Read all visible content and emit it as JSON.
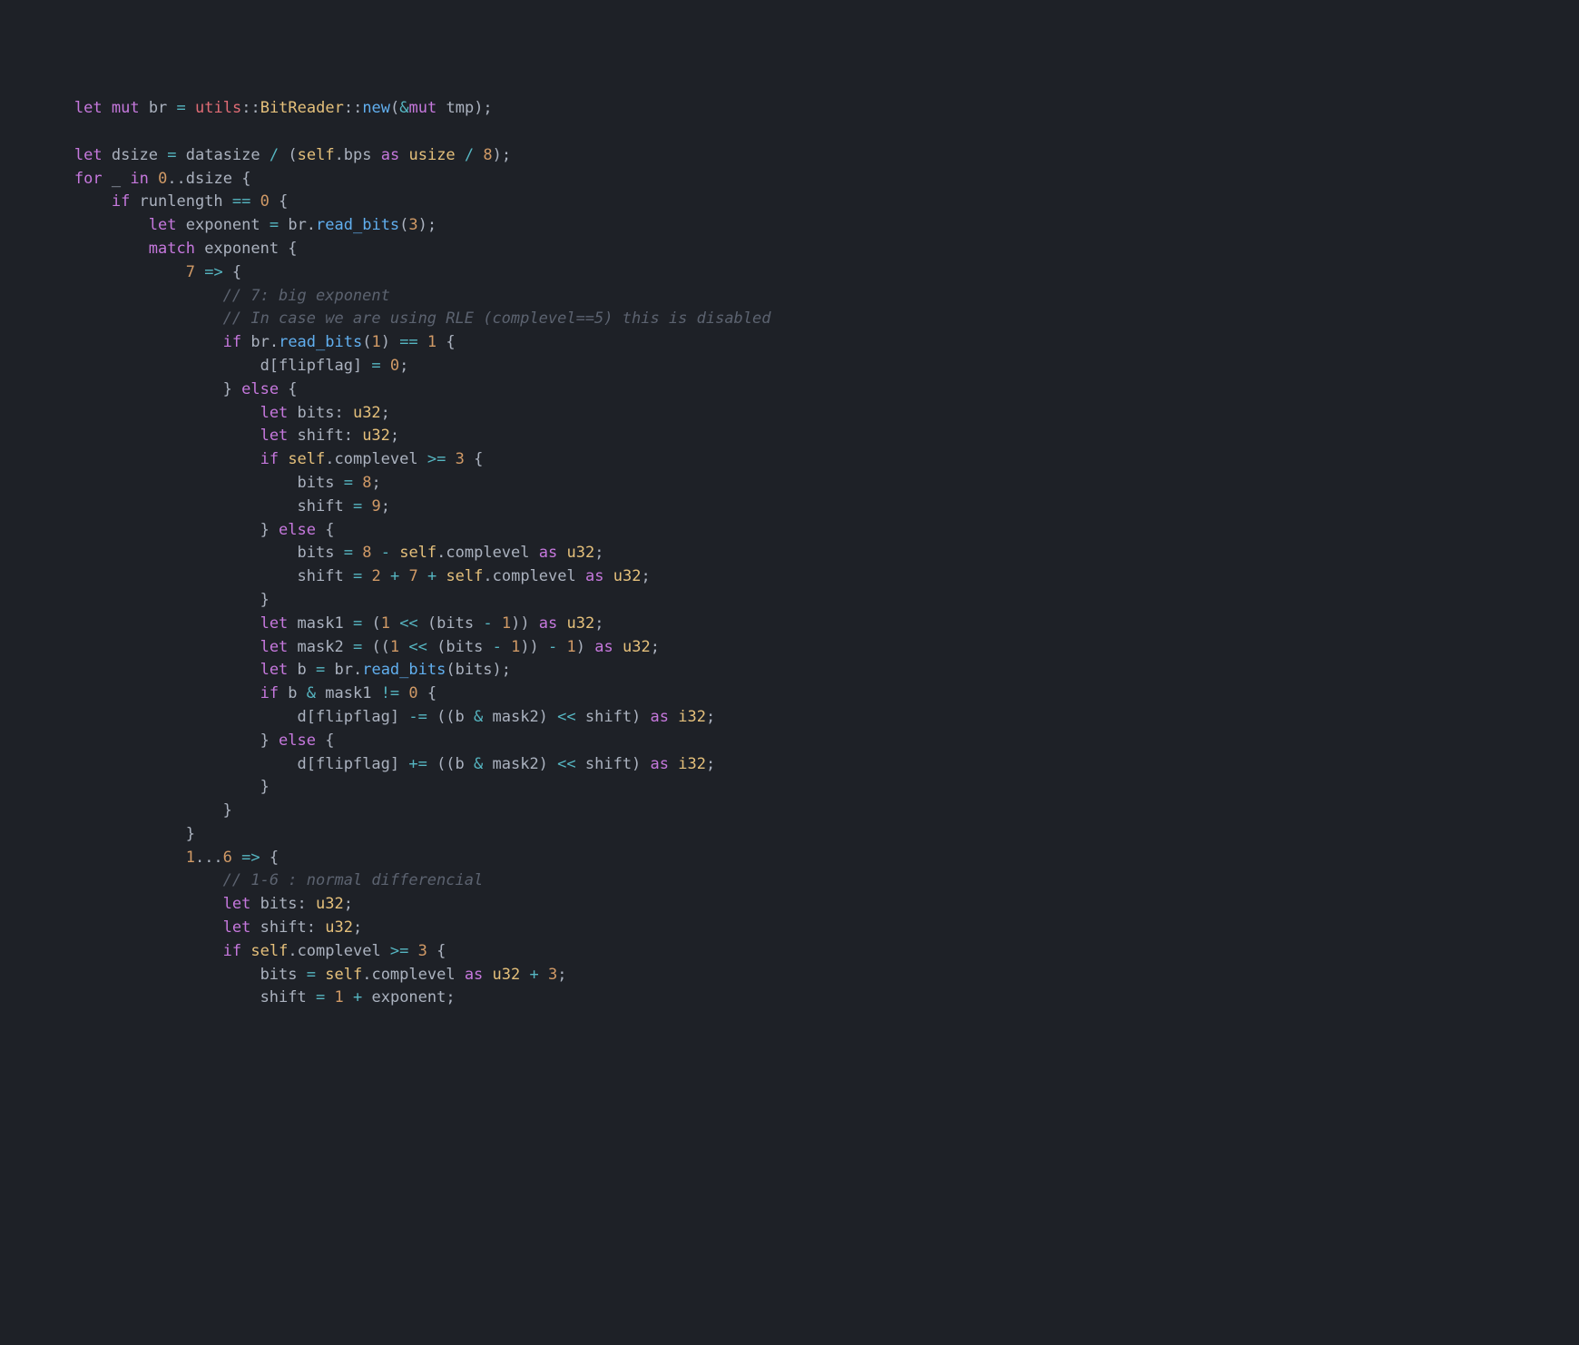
{
  "code": {
    "lines": [
      [
        [
          "        ",
          ""
        ],
        [
          "let",
          "kw"
        ],
        [
          " ",
          ""
        ],
        [
          "mut",
          "kw"
        ],
        [
          " br ",
          ""
        ],
        [
          "=",
          "op"
        ],
        [
          " ",
          ""
        ],
        [
          "utils",
          "var"
        ],
        [
          "::",
          ""
        ],
        [
          "BitReader",
          "type"
        ],
        [
          "::",
          ""
        ],
        [
          "new",
          "func"
        ],
        [
          "(",
          ""
        ],
        [
          "&",
          "op"
        ],
        [
          "mut",
          "kw"
        ],
        [
          " tmp);",
          ""
        ]
      ],
      [
        [
          "",
          ""
        ]
      ],
      [
        [
          "        ",
          ""
        ],
        [
          "let",
          "kw"
        ],
        [
          " dsize ",
          ""
        ],
        [
          "=",
          "op"
        ],
        [
          " datasize ",
          ""
        ],
        [
          "/",
          "op"
        ],
        [
          " (",
          ""
        ],
        [
          "self",
          "self"
        ],
        [
          ".bps ",
          ""
        ],
        [
          "as",
          "kw"
        ],
        [
          " ",
          ""
        ],
        [
          "usize",
          "type"
        ],
        [
          " ",
          ""
        ],
        [
          "/",
          "op"
        ],
        [
          " ",
          ""
        ],
        [
          "8",
          "num"
        ],
        [
          ");",
          ""
        ]
      ],
      [
        [
          "        ",
          ""
        ],
        [
          "for",
          "kw"
        ],
        [
          " _ ",
          ""
        ],
        [
          "in",
          "kw"
        ],
        [
          " ",
          ""
        ],
        [
          "0",
          "num"
        ],
        [
          "..",
          ""
        ],
        [
          "dsize {",
          ""
        ]
      ],
      [
        [
          "            ",
          ""
        ],
        [
          "if",
          "kw"
        ],
        [
          " runlength ",
          ""
        ],
        [
          "==",
          "op"
        ],
        [
          " ",
          ""
        ],
        [
          "0",
          "num"
        ],
        [
          " {",
          ""
        ]
      ],
      [
        [
          "                ",
          ""
        ],
        [
          "let",
          "kw"
        ],
        [
          " exponent ",
          ""
        ],
        [
          "=",
          "op"
        ],
        [
          " br.",
          ""
        ],
        [
          "read_bits",
          "func"
        ],
        [
          "(",
          ""
        ],
        [
          "3",
          "num"
        ],
        [
          ");",
          ""
        ]
      ],
      [
        [
          "                ",
          ""
        ],
        [
          "match",
          "kw"
        ],
        [
          " exponent {",
          ""
        ]
      ],
      [
        [
          "                    ",
          ""
        ],
        [
          "7",
          "num"
        ],
        [
          " ",
          ""
        ],
        [
          "=>",
          "op"
        ],
        [
          " {",
          ""
        ]
      ],
      [
        [
          "                        ",
          ""
        ],
        [
          "// 7: big exponent",
          "cmt"
        ]
      ],
      [
        [
          "                        ",
          ""
        ],
        [
          "// In case we are using RLE (complevel==5) this is disabled",
          "cmt"
        ]
      ],
      [
        [
          "                        ",
          ""
        ],
        [
          "if",
          "kw"
        ],
        [
          " br.",
          ""
        ],
        [
          "read_bits",
          "func"
        ],
        [
          "(",
          ""
        ],
        [
          "1",
          "num"
        ],
        [
          ") ",
          ""
        ],
        [
          "==",
          "op"
        ],
        [
          " ",
          ""
        ],
        [
          "1",
          "num"
        ],
        [
          " {",
          ""
        ]
      ],
      [
        [
          "                            d[flipflag] ",
          ""
        ],
        [
          "=",
          "op"
        ],
        [
          " ",
          ""
        ],
        [
          "0",
          "num"
        ],
        [
          ";",
          ""
        ]
      ],
      [
        [
          "                        } ",
          ""
        ],
        [
          "else",
          "kw"
        ],
        [
          " {",
          ""
        ]
      ],
      [
        [
          "                            ",
          ""
        ],
        [
          "let",
          "kw"
        ],
        [
          " bits: ",
          ""
        ],
        [
          "u32",
          "type"
        ],
        [
          ";",
          ""
        ]
      ],
      [
        [
          "                            ",
          ""
        ],
        [
          "let",
          "kw"
        ],
        [
          " shift: ",
          ""
        ],
        [
          "u32",
          "type"
        ],
        [
          ";",
          ""
        ]
      ],
      [
        [
          "                            ",
          ""
        ],
        [
          "if",
          "kw"
        ],
        [
          " ",
          ""
        ],
        [
          "self",
          "self"
        ],
        [
          ".complevel ",
          ""
        ],
        [
          ">=",
          "op"
        ],
        [
          " ",
          ""
        ],
        [
          "3",
          "num"
        ],
        [
          " {",
          ""
        ]
      ],
      [
        [
          "                                bits ",
          ""
        ],
        [
          "=",
          "op"
        ],
        [
          " ",
          ""
        ],
        [
          "8",
          "num"
        ],
        [
          ";",
          ""
        ]
      ],
      [
        [
          "                                shift ",
          ""
        ],
        [
          "=",
          "op"
        ],
        [
          " ",
          ""
        ],
        [
          "9",
          "num"
        ],
        [
          ";",
          ""
        ]
      ],
      [
        [
          "                            } ",
          ""
        ],
        [
          "else",
          "kw"
        ],
        [
          " {",
          ""
        ]
      ],
      [
        [
          "                                bits ",
          ""
        ],
        [
          "=",
          "op"
        ],
        [
          " ",
          ""
        ],
        [
          "8",
          "num"
        ],
        [
          " ",
          ""
        ],
        [
          "-",
          "op"
        ],
        [
          " ",
          ""
        ],
        [
          "self",
          "self"
        ],
        [
          ".complevel ",
          ""
        ],
        [
          "as",
          "kw"
        ],
        [
          " ",
          ""
        ],
        [
          "u32",
          "type"
        ],
        [
          ";",
          ""
        ]
      ],
      [
        [
          "                                shift ",
          ""
        ],
        [
          "=",
          "op"
        ],
        [
          " ",
          ""
        ],
        [
          "2",
          "num"
        ],
        [
          " ",
          ""
        ],
        [
          "+",
          "op"
        ],
        [
          " ",
          ""
        ],
        [
          "7",
          "num"
        ],
        [
          " ",
          ""
        ],
        [
          "+",
          "op"
        ],
        [
          " ",
          ""
        ],
        [
          "self",
          "self"
        ],
        [
          ".complevel ",
          ""
        ],
        [
          "as",
          "kw"
        ],
        [
          " ",
          ""
        ],
        [
          "u32",
          "type"
        ],
        [
          ";",
          ""
        ]
      ],
      [
        [
          "                            }",
          ""
        ]
      ],
      [
        [
          "                            ",
          ""
        ],
        [
          "let",
          "kw"
        ],
        [
          " mask1 ",
          ""
        ],
        [
          "=",
          "op"
        ],
        [
          " (",
          ""
        ],
        [
          "1",
          "num"
        ],
        [
          " ",
          ""
        ],
        [
          "<<",
          "op"
        ],
        [
          " (bits ",
          ""
        ],
        [
          "-",
          "op"
        ],
        [
          " ",
          ""
        ],
        [
          "1",
          "num"
        ],
        [
          ")) ",
          ""
        ],
        [
          "as",
          "kw"
        ],
        [
          " ",
          ""
        ],
        [
          "u32",
          "type"
        ],
        [
          ";",
          ""
        ]
      ],
      [
        [
          "                            ",
          ""
        ],
        [
          "let",
          "kw"
        ],
        [
          " mask2 ",
          ""
        ],
        [
          "=",
          "op"
        ],
        [
          " ((",
          ""
        ],
        [
          "1",
          "num"
        ],
        [
          " ",
          ""
        ],
        [
          "<<",
          "op"
        ],
        [
          " (bits ",
          ""
        ],
        [
          "-",
          "op"
        ],
        [
          " ",
          ""
        ],
        [
          "1",
          "num"
        ],
        [
          ")) ",
          ""
        ],
        [
          "-",
          "op"
        ],
        [
          " ",
          ""
        ],
        [
          "1",
          "num"
        ],
        [
          ") ",
          ""
        ],
        [
          "as",
          "kw"
        ],
        [
          " ",
          ""
        ],
        [
          "u32",
          "type"
        ],
        [
          ";",
          ""
        ]
      ],
      [
        [
          "                            ",
          ""
        ],
        [
          "let",
          "kw"
        ],
        [
          " b ",
          ""
        ],
        [
          "=",
          "op"
        ],
        [
          " br.",
          ""
        ],
        [
          "read_bits",
          "func"
        ],
        [
          "(bits);",
          ""
        ]
      ],
      [
        [
          "                            ",
          ""
        ],
        [
          "if",
          "kw"
        ],
        [
          " b ",
          ""
        ],
        [
          "&",
          "op"
        ],
        [
          " mask1 ",
          ""
        ],
        [
          "!=",
          "op"
        ],
        [
          " ",
          ""
        ],
        [
          "0",
          "num"
        ],
        [
          " {",
          ""
        ]
      ],
      [
        [
          "                                d[flipflag] ",
          ""
        ],
        [
          "-=",
          "op"
        ],
        [
          " ((b ",
          ""
        ],
        [
          "&",
          "op"
        ],
        [
          " mask2) ",
          ""
        ],
        [
          "<<",
          "op"
        ],
        [
          " shift) ",
          ""
        ],
        [
          "as",
          "kw"
        ],
        [
          " ",
          ""
        ],
        [
          "i32",
          "type"
        ],
        [
          ";",
          ""
        ]
      ],
      [
        [
          "                            } ",
          ""
        ],
        [
          "else",
          "kw"
        ],
        [
          " {",
          ""
        ]
      ],
      [
        [
          "                                d[flipflag] ",
          ""
        ],
        [
          "+=",
          "op"
        ],
        [
          " ((b ",
          ""
        ],
        [
          "&",
          "op"
        ],
        [
          " mask2) ",
          ""
        ],
        [
          "<<",
          "op"
        ],
        [
          " shift) ",
          ""
        ],
        [
          "as",
          "kw"
        ],
        [
          " ",
          ""
        ],
        [
          "i32",
          "type"
        ],
        [
          ";",
          ""
        ]
      ],
      [
        [
          "                            }",
          ""
        ]
      ],
      [
        [
          "                        }",
          ""
        ]
      ],
      [
        [
          "                    }",
          ""
        ]
      ],
      [
        [
          "                    ",
          ""
        ],
        [
          "1",
          "num"
        ],
        [
          "...",
          ""
        ],
        [
          "6",
          "num"
        ],
        [
          " ",
          ""
        ],
        [
          "=>",
          "op"
        ],
        [
          " {",
          ""
        ]
      ],
      [
        [
          "                        ",
          ""
        ],
        [
          "// 1-6 : normal differencial",
          "cmt"
        ]
      ],
      [
        [
          "                        ",
          ""
        ],
        [
          "let",
          "kw"
        ],
        [
          " bits: ",
          ""
        ],
        [
          "u32",
          "type"
        ],
        [
          ";",
          ""
        ]
      ],
      [
        [
          "                        ",
          ""
        ],
        [
          "let",
          "kw"
        ],
        [
          " shift: ",
          ""
        ],
        [
          "u32",
          "type"
        ],
        [
          ";",
          ""
        ]
      ],
      [
        [
          "                        ",
          ""
        ],
        [
          "if",
          "kw"
        ],
        [
          " ",
          ""
        ],
        [
          "self",
          "self"
        ],
        [
          ".complevel ",
          ""
        ],
        [
          ">=",
          "op"
        ],
        [
          " ",
          ""
        ],
        [
          "3",
          "num"
        ],
        [
          " {",
          ""
        ]
      ],
      [
        [
          "                            bits ",
          ""
        ],
        [
          "=",
          "op"
        ],
        [
          " ",
          ""
        ],
        [
          "self",
          "self"
        ],
        [
          ".complevel ",
          ""
        ],
        [
          "as",
          "kw"
        ],
        [
          " ",
          ""
        ],
        [
          "u32",
          "type"
        ],
        [
          " ",
          ""
        ],
        [
          "+",
          "op"
        ],
        [
          " ",
          ""
        ],
        [
          "3",
          "num"
        ],
        [
          ";",
          ""
        ]
      ],
      [
        [
          "                            shift ",
          ""
        ],
        [
          "=",
          "op"
        ],
        [
          " ",
          ""
        ],
        [
          "1",
          "num"
        ],
        [
          " ",
          ""
        ],
        [
          "+",
          "op"
        ],
        [
          " exponent;",
          ""
        ]
      ]
    ]
  }
}
